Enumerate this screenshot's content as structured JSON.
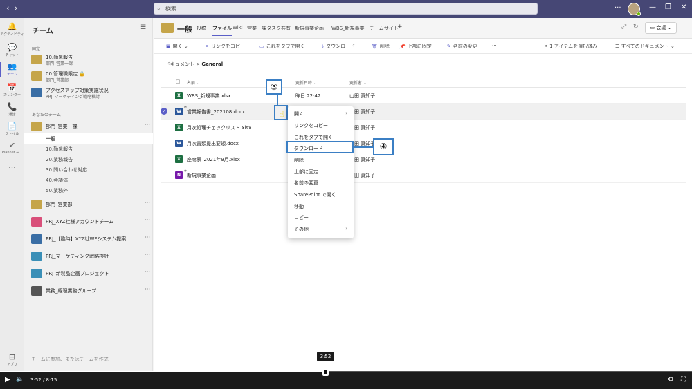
{
  "titlebar": {
    "back": "‹",
    "forward": "›",
    "search_placeholder": "検索",
    "more": "···",
    "minimize": "—",
    "restore": "❐",
    "close": "✕"
  },
  "rail": [
    {
      "icon": "bell-icon",
      "glyph": "🔔",
      "label": "アクティビティ"
    },
    {
      "icon": "chat-icon",
      "glyph": "💬",
      "label": "チャット"
    },
    {
      "icon": "teams-icon",
      "glyph": "👥",
      "label": "チーム"
    },
    {
      "icon": "calendar-icon",
      "glyph": "📅",
      "label": "カレンダー"
    },
    {
      "icon": "call-icon",
      "glyph": "📞",
      "label": "通話"
    },
    {
      "icon": "file-icon",
      "glyph": "📄",
      "label": "ファイル"
    },
    {
      "icon": "planner-icon",
      "glyph": "✔",
      "label": "Planner &..."
    },
    {
      "icon": "more-icon",
      "glyph": "···",
      "label": ""
    },
    {
      "icon": "apps-icon",
      "glyph": "⊞",
      "label": "アプリ"
    }
  ],
  "teams_panel": {
    "title": "チーム",
    "pinned_label": "固定",
    "your_teams_label": "あなたのチーム",
    "pinned": [
      {
        "name": "10.勤怠報告",
        "sub": "部門_営業一課",
        "color": "#c5a54a"
      },
      {
        "name": "00.管理職限定 🔒",
        "sub": "部門_営業部",
        "color": "#c5a54a"
      },
      {
        "name": "アクセスアップ対策実施状況",
        "sub": "PRJ_マーケティング戦略検討",
        "color": "#3a6ea5"
      }
    ],
    "team_main": {
      "name": "部門_営業一課",
      "color": "#c5a54a"
    },
    "channels": [
      "一般",
      "10.勤怠報告",
      "20.業務報告",
      "30.問い合わせ対応",
      "40.会議体",
      "50.業務外"
    ],
    "other_teams": [
      {
        "name": "部門_営業部",
        "color": "#c5a54a"
      },
      {
        "name": "PRJ_XYZ社様アカウントチーム",
        "color": "#d94f7a"
      },
      {
        "name": "PRJ_【臨時】XYZ社WFシステム提案",
        "color": "#3a6ea5"
      },
      {
        "name": "PRJ_マーケティング戦略検討",
        "color": "#3a8fb7"
      },
      {
        "name": "PRJ_新製品企画プロジェクト",
        "color": "#3a8fb7"
      },
      {
        "name": "業務_経理業務グループ",
        "color": "#555555"
      }
    ],
    "more": "···",
    "join_text": "チームに参加、またはチームを作成"
  },
  "header": {
    "channel": "一般",
    "tabs": [
      "投稿",
      "ファイル",
      "Wiki",
      "営業一課タスク共有",
      "新規事業企画",
      "WBS_新規事業",
      "チームサイト",
      "+"
    ],
    "active_tab": "ファイル",
    "meet": "会議"
  },
  "commands": {
    "open": "開く",
    "copy_link": "リンクをコピー",
    "open_tab": "これをタブで開く",
    "download": "ダウンロード",
    "delete": "削除",
    "pin_top": "上部に固定",
    "rename": "名前の変更",
    "more": "···",
    "selected": "1 アイテムを選択済み",
    "all_docs": "すべてのドキュメント"
  },
  "breadcrumb": {
    "root": "ドキュメント",
    "current": "General"
  },
  "columns": {
    "name": "名前",
    "modified": "更新日時",
    "modified_by": "更新者"
  },
  "files": [
    {
      "name": "WBS_新規事業.xlsx",
      "type": "X",
      "color": "#1d6f42",
      "date": "昨日 22:42",
      "user": "山田 真知子",
      "selected": false
    },
    {
      "name": "営業報告書_202108.docx",
      "type": "W",
      "color": "#2b579a",
      "date": "",
      "user": "山田 真知子",
      "selected": true
    },
    {
      "name": "月次処理チェックリスト.xlsx",
      "type": "X",
      "color": "#1d6f42",
      "date": "",
      "user": "山田 真知子",
      "selected": false
    },
    {
      "name": "月次書類提出要領.docx",
      "type": "W",
      "color": "#2b579a",
      "date": "",
      "user": "山田 真知子",
      "selected": false
    },
    {
      "name": "座席表_2021年9月.xlsx",
      "type": "X",
      "color": "#1d6f42",
      "date": "",
      "user": "山田 真知子",
      "selected": false
    },
    {
      "name": "新規事業企画",
      "type": "N",
      "color": "#7719aa",
      "date": "",
      "user": "山田 真知子",
      "selected": false
    }
  ],
  "menu": {
    "items": [
      "開く",
      "リンクをコピー",
      "これをタブで開く",
      "ダウンロード",
      "削除",
      "上部に固定",
      "名前の変更",
      "SharePoint で開く",
      "移動",
      "コピー",
      "その他"
    ],
    "submenu_arrow": "›"
  },
  "annotations": {
    "step3": "③",
    "step4": "④"
  },
  "video": {
    "current": "3:52",
    "total": "8:15",
    "tooltip": "3:52",
    "progress": 0.47
  }
}
